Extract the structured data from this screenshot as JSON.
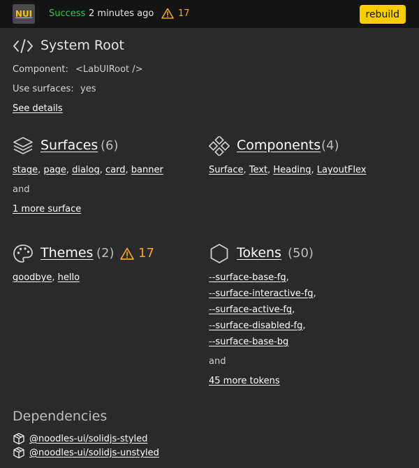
{
  "topbar": {
    "logo": "NUI",
    "status": "Success",
    "time": "2 minutes ago",
    "warnings": "17",
    "rebuild_label": "rebuild"
  },
  "system_root": {
    "title": "System Root",
    "component_label": "Component:",
    "component_value": "<LabUIRoot />",
    "surfaces_label": "Use surfaces:",
    "surfaces_value": "yes",
    "details_link": "See details"
  },
  "surfaces": {
    "title": "Surfaces",
    "count": "(6)",
    "items": [
      "stage",
      "page",
      "dialog",
      "card",
      "banner"
    ],
    "and": "and",
    "more": "1 more surface"
  },
  "components": {
    "title": "Components",
    "count": "(4)",
    "items": [
      "Surface",
      "Text",
      "Heading",
      "LayoutFlex"
    ]
  },
  "themes": {
    "title": "Themes",
    "count": "(2)",
    "warnings": "17",
    "items": [
      "goodbye",
      "hello"
    ]
  },
  "tokens": {
    "title": "Tokens",
    "count": "(50)",
    "items": [
      "--surface-base-fg",
      "--surface-interactive-fg",
      "--surface-active-fg",
      "--surface-disabled-fg",
      "--surface-base-bg"
    ],
    "and": "and",
    "more": "45 more tokens"
  },
  "dependencies": {
    "title": "Dependencies",
    "items": [
      "@noodles-ui/solidjs-styled",
      "@noodles-ui/solidjs-unstyled"
    ]
  },
  "colors": {
    "success": "#36c54a",
    "warning": "#f5a623",
    "accent": "#f7cc00",
    "background": "#2a2a2a",
    "topbar": "#141414"
  },
  "icons": [
    "code-icon",
    "layers-icon",
    "components-icon",
    "palette-icon",
    "hexagon-icon",
    "package-icon",
    "warning-icon"
  ]
}
